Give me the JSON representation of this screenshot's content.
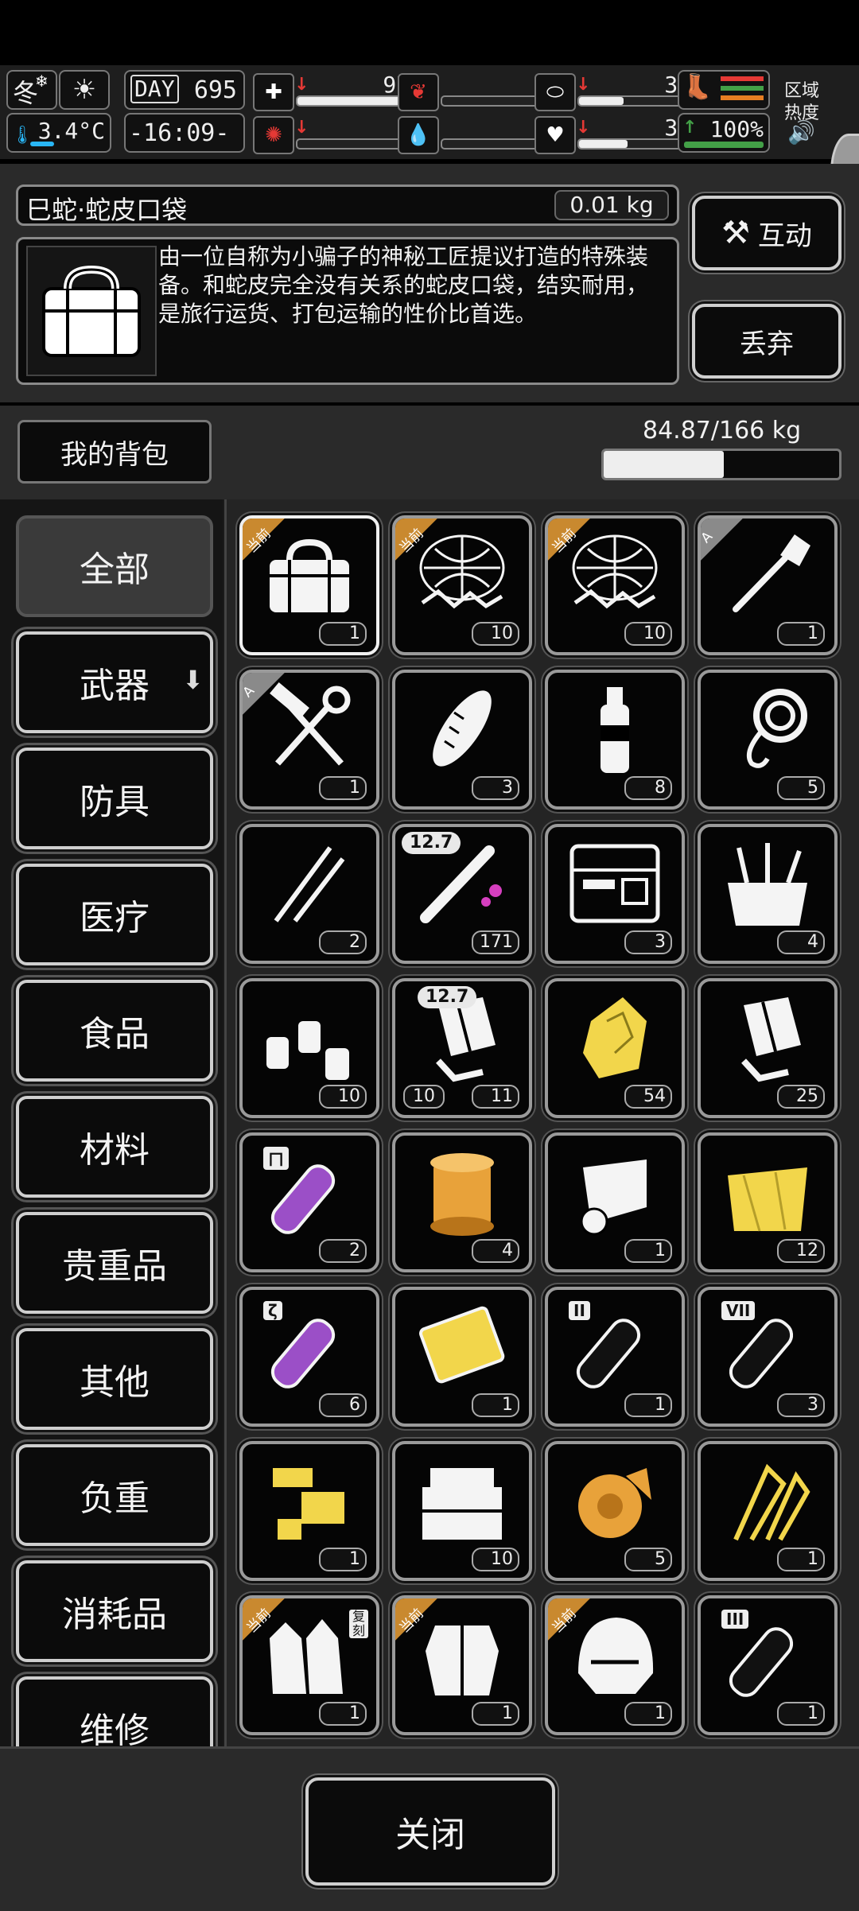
{
  "status": {
    "season": "冬",
    "temperature": "3.4°C",
    "day_label": "DAY",
    "day": "695",
    "time": "-16:09-",
    "zone_label_1": "区域",
    "zone_label_2": "热度",
    "stats": [
      {
        "name": "health",
        "value": "97%",
        "level": 0.97,
        "trend": "down"
      },
      {
        "name": "hunger",
        "value": "0%",
        "level": 0.0,
        "trend": ""
      },
      {
        "name": "thirst",
        "value": "36%",
        "level": 0.36,
        "trend": "down"
      },
      {
        "name": "infection",
        "value": "0%",
        "level": 0.0,
        "trend": "down"
      },
      {
        "name": "bleeding",
        "value": "0%",
        "level": 0.0,
        "trend": ""
      },
      {
        "name": "mood",
        "value": "39%",
        "level": 0.39,
        "trend": "down"
      }
    ],
    "stamina": {
      "value": "100%",
      "level": 1.0,
      "trend": "up"
    }
  },
  "item": {
    "name": "巳蛇·蛇皮口袋",
    "weight": "0.01 kg",
    "description": "由一位自称为小骗子的神秘工匠提议打造的特殊装备。和蛇皮完全没有关系的蛇皮口袋，结实耐用，是旅行运货、打包运输的性价比首选。",
    "interact_label": "互动",
    "discard_label": "丢弃"
  },
  "backpack": {
    "title": "我的背包",
    "capacity": "84.87/166 kg",
    "load_level": 0.511
  },
  "categories": [
    {
      "label": "全部",
      "active": true
    },
    {
      "label": "武器",
      "active": false,
      "arrow": "⬇"
    },
    {
      "label": "防具",
      "active": false
    },
    {
      "label": "医疗",
      "active": false
    },
    {
      "label": "食品",
      "active": false
    },
    {
      "label": "材料",
      "active": false
    },
    {
      "label": "贵重品",
      "active": false
    },
    {
      "label": "其他",
      "active": false
    },
    {
      "label": "负重",
      "active": false
    },
    {
      "label": "消耗品",
      "active": false
    },
    {
      "label": "维修",
      "active": false
    }
  ],
  "items": [
    {
      "icon": "bag",
      "count": "1",
      "tag": "当前",
      "selected": true
    },
    {
      "icon": "net-trap",
      "count": "10",
      "tag": "当前"
    },
    {
      "icon": "net-trap",
      "count": "10",
      "tag": "当前"
    },
    {
      "icon": "shovel",
      "count": "1",
      "tag": "A"
    },
    {
      "icon": "hammer-wrench",
      "count": "1",
      "tag": "A"
    },
    {
      "icon": "bread",
      "count": "3"
    },
    {
      "icon": "water-bottle",
      "count": "8"
    },
    {
      "icon": "rope",
      "count": "5"
    },
    {
      "icon": "lockpicks",
      "count": "2"
    },
    {
      "icon": "bullet",
      "count": "171",
      "caliber": "12.7"
    },
    {
      "icon": "toolkit",
      "count": "3"
    },
    {
      "icon": "tool-bag",
      "count": "4"
    },
    {
      "icon": "bottles",
      "count": "10"
    },
    {
      "icon": "magazine",
      "count": "11",
      "caliber": "12.7",
      "count2": "10"
    },
    {
      "icon": "gold-ore",
      "count": "54"
    },
    {
      "icon": "magazine",
      "count": "25"
    },
    {
      "icon": "test-tube-purple",
      "count": "2",
      "tube_label": "ㄇ"
    },
    {
      "icon": "thread-spool",
      "count": "4"
    },
    {
      "icon": "paper-roll",
      "count": "1"
    },
    {
      "icon": "cloth",
      "count": "12"
    },
    {
      "icon": "test-tube-purple",
      "count": "6",
      "tube_label": "ζ"
    },
    {
      "icon": "gold-plate",
      "count": "1"
    },
    {
      "icon": "test-tube",
      "count": "1",
      "tube_label": "II"
    },
    {
      "icon": "test-tube",
      "count": "3",
      "tube_label": "VII"
    },
    {
      "icon": "gold-parts",
      "count": "1"
    },
    {
      "icon": "parts-box",
      "count": "10"
    },
    {
      "icon": "gold-roll",
      "count": "5"
    },
    {
      "icon": "gold-clips",
      "count": "1"
    },
    {
      "icon": "gloves",
      "count": "1",
      "tag": "当前",
      "stamp": "复刻"
    },
    {
      "icon": "armor",
      "count": "1",
      "tag": "当前"
    },
    {
      "icon": "helmet",
      "count": "1",
      "tag": "当前"
    },
    {
      "icon": "test-tube",
      "count": "1",
      "tube_label": "III"
    }
  ],
  "close_label": "关闭",
  "colors": {
    "accent_gold": "#c9892f",
    "tag_gray": "#8a8a8a",
    "purple": "#9b4fc7",
    "yellow": "#f2d64b",
    "red": "#e53935",
    "green": "#43a047"
  }
}
